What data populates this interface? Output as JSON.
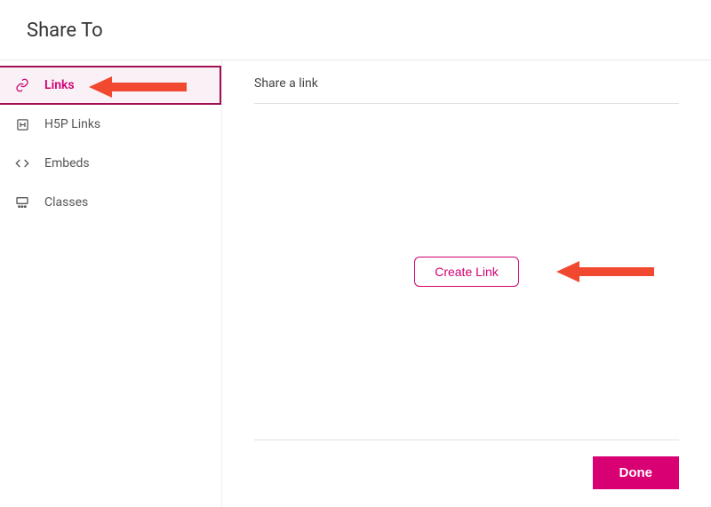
{
  "header": {
    "title": "Share To"
  },
  "sidebar": {
    "items": [
      {
        "label": "Links",
        "icon": "link-icon",
        "active": true
      },
      {
        "label": "H5P Links",
        "icon": "h5p-icon",
        "active": false
      },
      {
        "label": "Embeds",
        "icon": "code-icon",
        "active": false
      },
      {
        "label": "Classes",
        "icon": "classes-icon",
        "active": false
      }
    ]
  },
  "main": {
    "section_title": "Share a link",
    "create_button_label": "Create Link",
    "done_button_label": "Done"
  },
  "colors": {
    "accent": "#cf0072",
    "accent_dark": "#a30f55",
    "done_bg": "#d90073",
    "annotation": "#f0492f"
  }
}
